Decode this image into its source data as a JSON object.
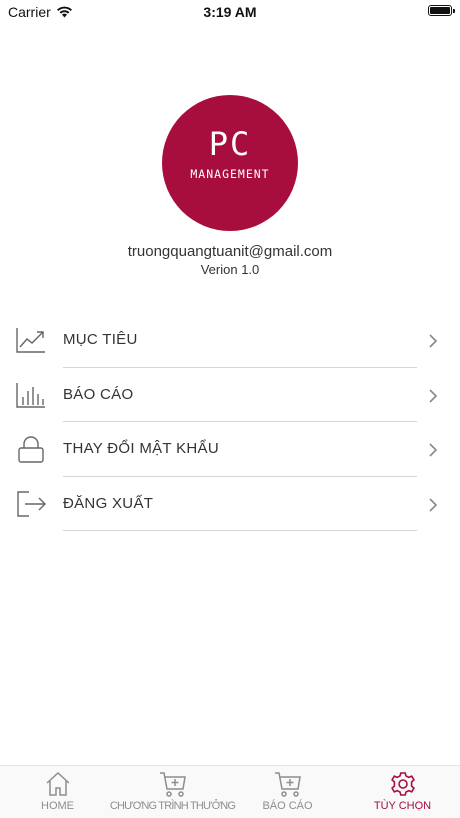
{
  "status_bar": {
    "carrier": "Carrier",
    "time": "3:19 AM"
  },
  "profile": {
    "logo_title": "PC",
    "logo_subtitle": "MANAGEMENT",
    "email": "truongquangtuanit@gmail.com",
    "version": "Verion 1.0"
  },
  "menu": {
    "items": [
      {
        "label": "MỤC TIÊU",
        "icon": "trending-chart-icon"
      },
      {
        "label": "BÁO CÁO",
        "icon": "bar-chart-icon"
      },
      {
        "label": "THAY ĐỔI MẬT KHẨU",
        "icon": "lock-icon"
      },
      {
        "label": "ĐĂNG XUẤT",
        "icon": "logout-icon"
      }
    ]
  },
  "tab_bar": {
    "tabs": [
      {
        "label": "HOME",
        "icon": "home-icon",
        "active": false
      },
      {
        "label": "CHƯƠNG TRÌNH THƯỞNG",
        "icon": "cart-add-icon",
        "active": false
      },
      {
        "label": "BÁO CÁO",
        "icon": "cart-add-icon",
        "active": false
      },
      {
        "label": "TÙY CHỌN",
        "icon": "gear-icon",
        "active": true
      }
    ]
  },
  "colors": {
    "accent": "#a70e3d",
    "tab_inactive": "#8e8e8e",
    "menu_icon": "#666666",
    "divider": "#d6d6d6"
  }
}
